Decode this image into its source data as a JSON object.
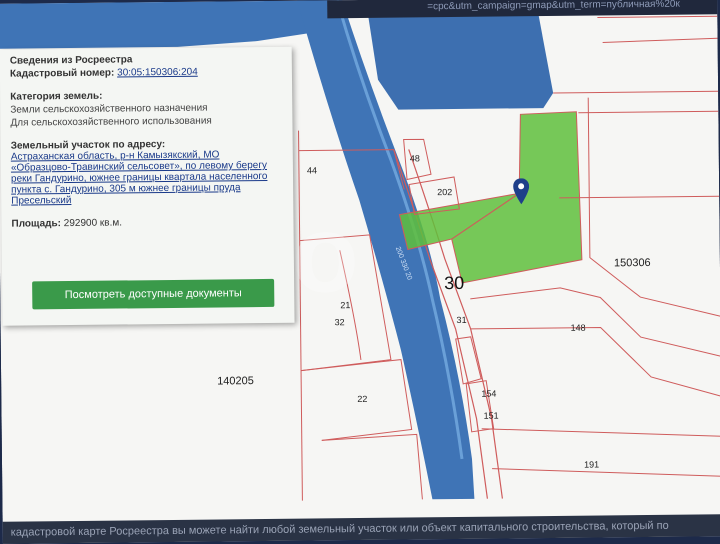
{
  "url_fragment": "=cpc&utm_campaign=gmap&utm_term=публичная%20к",
  "info": {
    "title": "Сведения из Росреестра",
    "cadastral_label": "Кадастровый номер:",
    "cadastral_value": "30:05:150306:204",
    "category_label": "Категория земель:",
    "category_line1": "Земли сельскохозяйственного назначения",
    "category_line2": "Для сельскохозяйственного использования",
    "address_label": "Земельный участок по адресу:",
    "address_line1": "Астраханская область, р-н Камызякский, МО",
    "address_line2": "«Образцово-Травинский сельсовет», по левому берегу",
    "address_line3": "реки Гандурино, южнее границы квартала населенного",
    "address_line4": "пункта с. Гандурино, 305 м южнее границы пруда",
    "address_line5": "Пресельский",
    "area_label": "Площадь:",
    "area_value": "292900 кв.м.",
    "docs_button": "Посмотреть доступные документы"
  },
  "map_labels": {
    "l44": "44",
    "l48": "48",
    "l202": "202",
    "l30": "30",
    "l150306": "150306",
    "l148": "148",
    "l140205": "140205",
    "l21": "21",
    "l32": "32",
    "l22": "22",
    "l154": "154",
    "l151": "151",
    "l191": "191",
    "l31": "31"
  },
  "bottom_text": "кадастровой карте Росреестра вы можете найти любой земельный участок или объект капитального строительства, который по",
  "watermark": "Avito",
  "colors": {
    "water": "#3f74b6",
    "parcel_green": "#5fbf3c",
    "boundary": "#cf5c5c",
    "button": "#3a9a4a"
  }
}
